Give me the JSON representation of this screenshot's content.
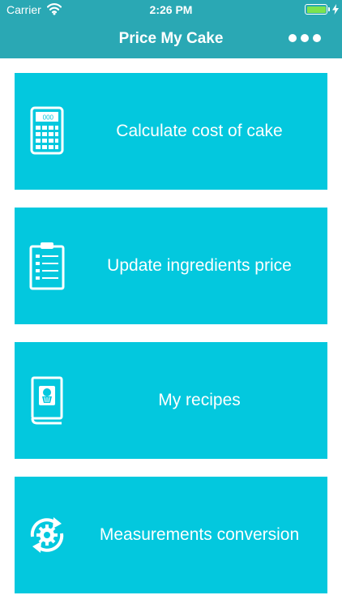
{
  "status_bar": {
    "carrier": "Carrier",
    "time": "2:26 PM",
    "battery_level": 1.0,
    "battery_color": "#7ce34f"
  },
  "nav": {
    "title": "Price My Cake",
    "more_icon": "more-horizontal-icon"
  },
  "colors": {
    "nav_bar": "#2aa8b4",
    "tile": "#03c8de",
    "text": "#ffffff"
  },
  "menu": [
    {
      "label": "Calculate cost of cake",
      "icon": "calculator-icon"
    },
    {
      "label": "Update ingredients price",
      "icon": "clipboard-list-icon"
    },
    {
      "label": "My recipes",
      "icon": "recipe-book-icon"
    },
    {
      "label": "Measurements conversion",
      "icon": "conversion-gear-icon"
    }
  ]
}
